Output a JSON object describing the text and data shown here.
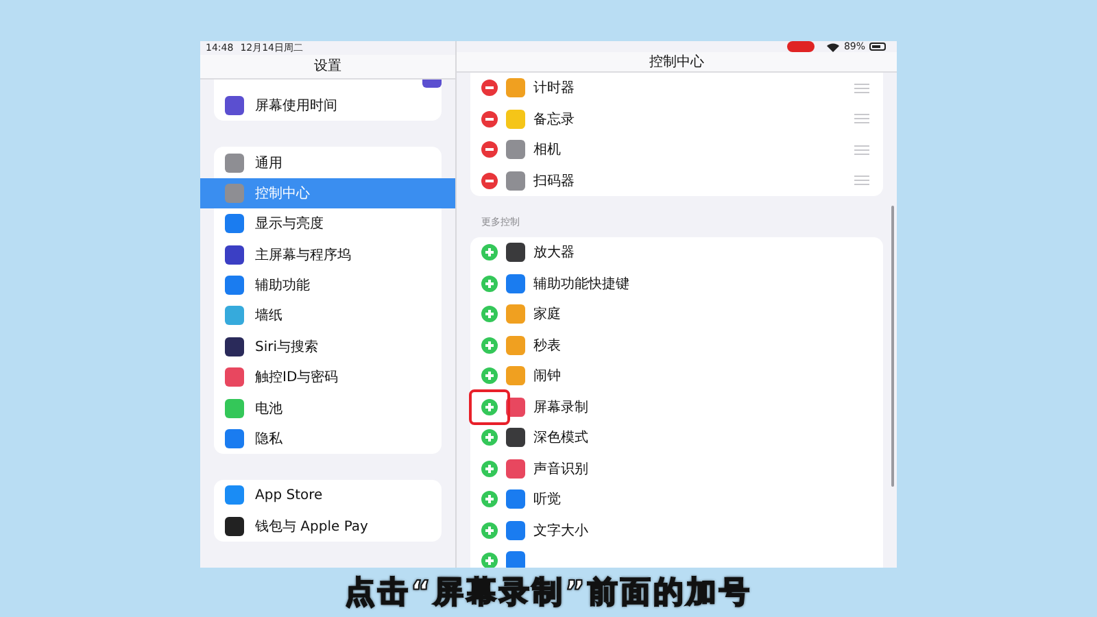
{
  "status_bar": {
    "time": "14:48",
    "date": "12月14日周二",
    "battery": "89%"
  },
  "sidebar": {
    "title": "设置",
    "groups": [
      [
        {
          "label": "屏幕使用时间",
          "color": "#5b4fd0",
          "selected": false
        }
      ],
      [
        {
          "label": "通用",
          "color": "#8e8e93",
          "selected": false
        },
        {
          "label": "控制中心",
          "color": "#8e8e93",
          "selected": true
        },
        {
          "label": "显示与亮度",
          "color": "#1a7cf0",
          "selected": false
        },
        {
          "label": "主屏幕与程序坞",
          "color": "#3b3fc4",
          "selected": false
        },
        {
          "label": "辅助功能",
          "color": "#1a7cf0",
          "selected": false
        },
        {
          "label": "墙纸",
          "color": "#36aadc",
          "selected": false
        },
        {
          "label": "Siri与搜索",
          "color": "#2a2a5a",
          "selected": false
        },
        {
          "label": "触控ID与密码",
          "color": "#e8475f",
          "selected": false
        },
        {
          "label": "电池",
          "color": "#34c759",
          "selected": false
        },
        {
          "label": "隐私",
          "color": "#1a7cf0",
          "selected": false
        }
      ],
      [
        {
          "label": "App Store",
          "color": "#1a8cf5",
          "selected": false
        },
        {
          "label": "钱包与 Apple Pay",
          "color": "#222222",
          "selected": false
        }
      ]
    ]
  },
  "detail": {
    "title": "控制中心",
    "included": [
      {
        "label": "计时器",
        "color": "#f0a020"
      },
      {
        "label": "备忘录",
        "color": "#f5c518"
      },
      {
        "label": "相机",
        "color": "#8e8e93"
      },
      {
        "label": "扫码器",
        "color": "#8e8e93"
      }
    ],
    "section_header": "更多控制",
    "more": [
      {
        "label": "放大器",
        "color": "#3a3a3c",
        "highlighted": false
      },
      {
        "label": "辅助功能快捷键",
        "color": "#1a7cf0",
        "highlighted": false
      },
      {
        "label": "家庭",
        "color": "#f0a020",
        "highlighted": false
      },
      {
        "label": "秒表",
        "color": "#f0a020",
        "highlighted": false
      },
      {
        "label": "闹钟",
        "color": "#f0a020",
        "highlighted": false
      },
      {
        "label": "屏幕录制",
        "color": "#e8475f",
        "highlighted": true
      },
      {
        "label": "深色模式",
        "color": "#3a3a3c",
        "highlighted": false
      },
      {
        "label": "声音识别",
        "color": "#e8475f",
        "highlighted": false
      },
      {
        "label": "听觉",
        "color": "#1a7cf0",
        "highlighted": false
      },
      {
        "label": "文字大小",
        "color": "#1a7cf0",
        "highlighted": false
      }
    ]
  },
  "caption": "点击“屏幕录制”前面的加号"
}
